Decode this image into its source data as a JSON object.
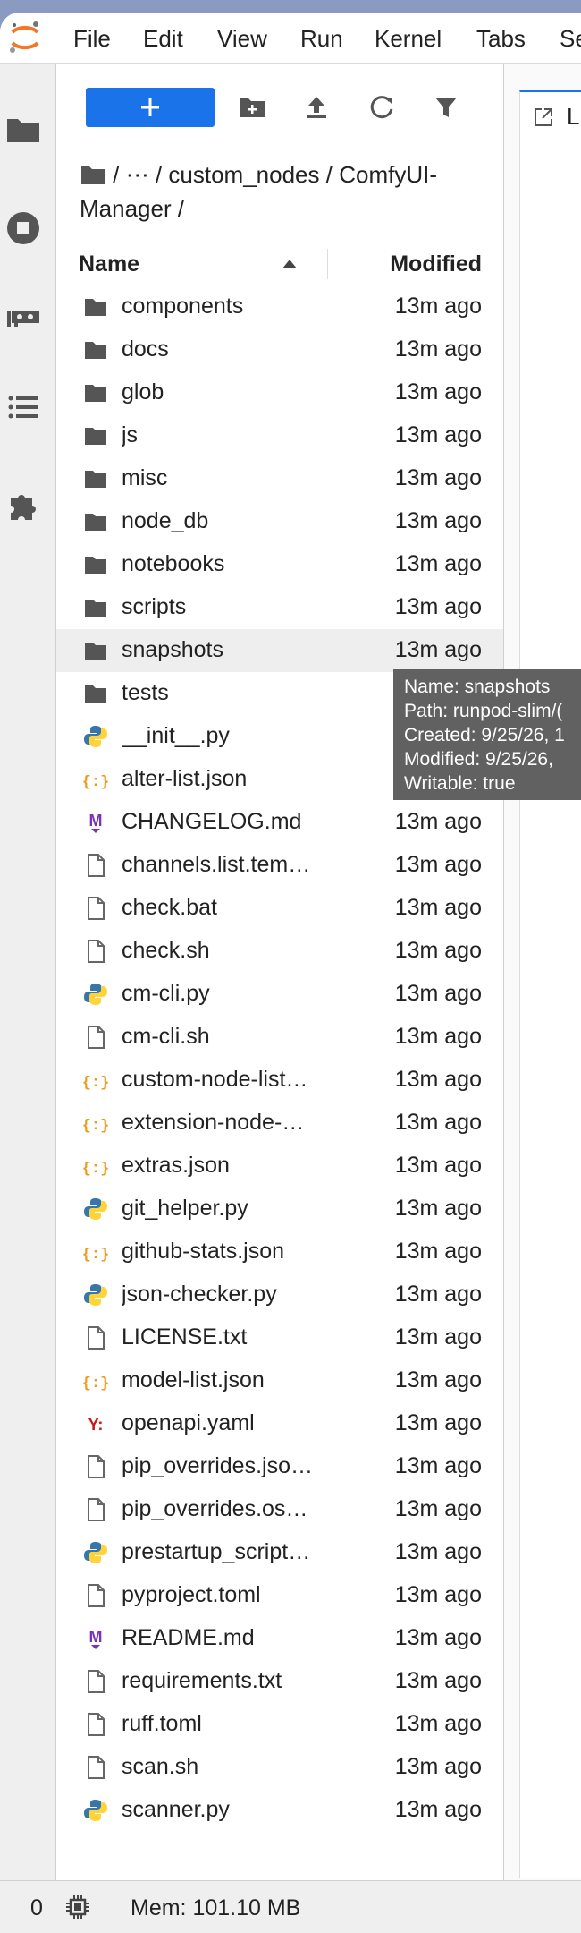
{
  "menubar": {
    "items": [
      "File",
      "Edit",
      "View",
      "Run",
      "Kernel",
      "Tabs",
      "Se"
    ]
  },
  "breadcrumb": {
    "parts": [
      "/",
      "⋯",
      "/",
      "custom_nodes",
      "/",
      "ComfyUI-Manager",
      "/"
    ]
  },
  "filelist": {
    "col_name": "Name",
    "col_modified": "Modified",
    "rows": [
      {
        "name": "components",
        "modified": "13m ago",
        "icon": "folder-icon"
      },
      {
        "name": "docs",
        "modified": "13m ago",
        "icon": "folder-icon"
      },
      {
        "name": "glob",
        "modified": "13m ago",
        "icon": "folder-icon"
      },
      {
        "name": "js",
        "modified": "13m ago",
        "icon": "folder-icon"
      },
      {
        "name": "misc",
        "modified": "13m ago",
        "icon": "folder-icon"
      },
      {
        "name": "node_db",
        "modified": "13m ago",
        "icon": "folder-icon"
      },
      {
        "name": "notebooks",
        "modified": "13m ago",
        "icon": "folder-icon"
      },
      {
        "name": "scripts",
        "modified": "13m ago",
        "icon": "folder-icon"
      },
      {
        "name": "snapshots",
        "modified": "13m ago",
        "icon": "folder-icon"
      },
      {
        "name": "tests",
        "modified": "",
        "icon": "folder-icon"
      },
      {
        "name": "__init__.py",
        "modified": "",
        "icon": "python-icon"
      },
      {
        "name": "alter-list.json",
        "modified": "",
        "icon": "json-icon"
      },
      {
        "name": "CHANGELOG.md",
        "modified": "13m ago",
        "icon": "markdown-icon"
      },
      {
        "name": "channels.list.tem…",
        "modified": "13m ago",
        "icon": "file-icon"
      },
      {
        "name": "check.bat",
        "modified": "13m ago",
        "icon": "file-icon"
      },
      {
        "name": "check.sh",
        "modified": "13m ago",
        "icon": "file-icon"
      },
      {
        "name": "cm-cli.py",
        "modified": "13m ago",
        "icon": "python-icon"
      },
      {
        "name": "cm-cli.sh",
        "modified": "13m ago",
        "icon": "file-icon"
      },
      {
        "name": "custom-node-list…",
        "modified": "13m ago",
        "icon": "json-icon"
      },
      {
        "name": "extension-node-…",
        "modified": "13m ago",
        "icon": "json-icon"
      },
      {
        "name": "extras.json",
        "modified": "13m ago",
        "icon": "json-icon"
      },
      {
        "name": "git_helper.py",
        "modified": "13m ago",
        "icon": "python-icon"
      },
      {
        "name": "github-stats.json",
        "modified": "13m ago",
        "icon": "json-icon"
      },
      {
        "name": "json-checker.py",
        "modified": "13m ago",
        "icon": "python-icon"
      },
      {
        "name": "LICENSE.txt",
        "modified": "13m ago",
        "icon": "file-icon"
      },
      {
        "name": "model-list.json",
        "modified": "13m ago",
        "icon": "json-icon"
      },
      {
        "name": "openapi.yaml",
        "modified": "13m ago",
        "icon": "yaml-icon"
      },
      {
        "name": "pip_overrides.jso…",
        "modified": "13m ago",
        "icon": "file-icon"
      },
      {
        "name": "pip_overrides.os…",
        "modified": "13m ago",
        "icon": "file-icon"
      },
      {
        "name": "prestartup_script…",
        "modified": "13m ago",
        "icon": "python-icon"
      },
      {
        "name": "pyproject.toml",
        "modified": "13m ago",
        "icon": "file-icon"
      },
      {
        "name": "README.md",
        "modified": "13m ago",
        "icon": "markdown-icon"
      },
      {
        "name": "requirements.txt",
        "modified": "13m ago",
        "icon": "file-icon"
      },
      {
        "name": "ruff.toml",
        "modified": "13m ago",
        "icon": "file-icon"
      },
      {
        "name": "scan.sh",
        "modified": "13m ago",
        "icon": "file-icon"
      },
      {
        "name": "scanner.py",
        "modified": "13m ago",
        "icon": "python-icon"
      }
    ]
  },
  "tooltip": {
    "lines": [
      "Name: snapshots",
      "Path: runpod-slim/(",
      "Created: 9/25/26, 1",
      "Modified: 9/25/26,",
      "Writable: true"
    ]
  },
  "main_tab": {
    "label": "L"
  },
  "statusbar": {
    "count": "0",
    "memory": "Mem: 101.10 MB"
  },
  "colors": {
    "accent": "#1a73e8",
    "python_blue": "#3776ab",
    "python_yellow": "#ffd43b",
    "json_orange": "#f09a1a",
    "markdown_purple": "#7b2fbe",
    "yaml_red": "#cb171e"
  }
}
